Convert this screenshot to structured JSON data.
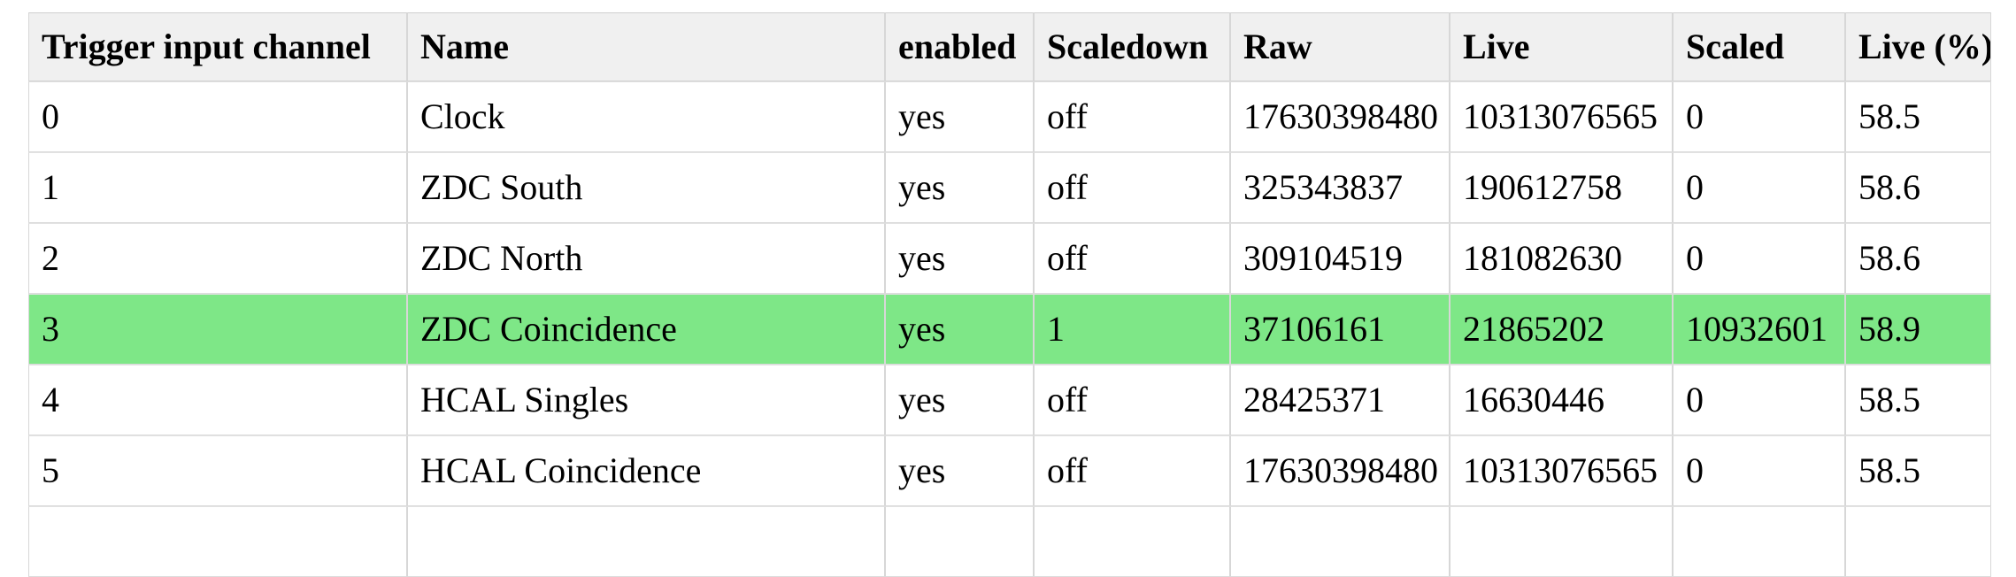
{
  "table": {
    "columns": [
      {
        "key": "channel",
        "label": "Trigger input channel"
      },
      {
        "key": "name",
        "label": "Name"
      },
      {
        "key": "enabled",
        "label": "enabled"
      },
      {
        "key": "scaledown",
        "label": "Scaledown"
      },
      {
        "key": "raw",
        "label": "Raw"
      },
      {
        "key": "live",
        "label": "Live"
      },
      {
        "key": "scaled",
        "label": "Scaled"
      },
      {
        "key": "livepct",
        "label": "Live (%)"
      }
    ],
    "rows": [
      {
        "channel": "0",
        "name": "Clock",
        "enabled": "yes",
        "scaledown": "off",
        "raw": "17630398480",
        "live": "10313076565",
        "scaled": "0",
        "livepct": "58.5",
        "highlighted": false
      },
      {
        "channel": "1",
        "name": "ZDC South",
        "enabled": "yes",
        "scaledown": "off",
        "raw": "325343837",
        "live": "190612758",
        "scaled": "0",
        "livepct": "58.6",
        "highlighted": false
      },
      {
        "channel": "2",
        "name": "ZDC North",
        "enabled": "yes",
        "scaledown": "off",
        "raw": "309104519",
        "live": "181082630",
        "scaled": "0",
        "livepct": "58.6",
        "highlighted": false
      },
      {
        "channel": "3",
        "name": "ZDC Coincidence",
        "enabled": "yes",
        "scaledown": "1",
        "raw": "37106161",
        "live": "21865202",
        "scaled": "10932601",
        "livepct": "58.9",
        "highlighted": true
      },
      {
        "channel": "4",
        "name": "HCAL Singles",
        "enabled": "yes",
        "scaledown": "off",
        "raw": "28425371",
        "live": "16630446",
        "scaled": "0",
        "livepct": "58.5",
        "highlighted": false
      },
      {
        "channel": "5",
        "name": "HCAL Coincidence",
        "enabled": "yes",
        "scaledown": "off",
        "raw": "17630398480",
        "live": "10313076565",
        "scaled": "0",
        "livepct": "58.5",
        "highlighted": false
      },
      {
        "channel": "",
        "name": "",
        "enabled": "",
        "scaledown": "",
        "raw": "",
        "live": "",
        "scaled": "",
        "livepct": "",
        "highlighted": false
      }
    ],
    "colors": {
      "header_background": "#f0f0f0",
      "row_background": "#ffffff",
      "highlight_background": "#7ee787",
      "border": "#d7d7d7",
      "text": "#000000"
    }
  }
}
